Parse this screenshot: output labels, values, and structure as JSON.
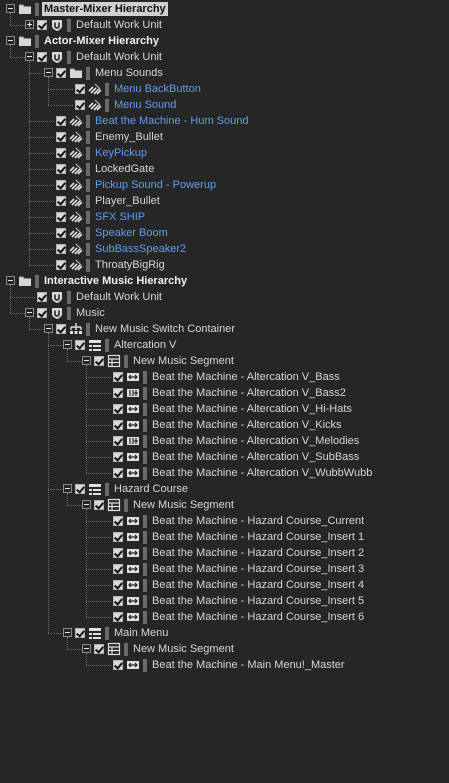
{
  "tree": [
    {
      "label": "Master-Mixer Hierarchy",
      "icon": "folder",
      "expander": "minus",
      "checkbox": false,
      "bold": true,
      "selected": true,
      "blue": false,
      "depth": 0
    },
    {
      "label": "Default Work Unit",
      "icon": "work-unit",
      "expander": "plus",
      "checkbox": true,
      "depth": 1
    },
    {
      "label": "Actor-Mixer Hierarchy",
      "icon": "folder",
      "expander": "minus",
      "checkbox": false,
      "bold": true,
      "depth": 0
    },
    {
      "label": "Default Work Unit",
      "icon": "work-unit",
      "expander": "minus",
      "checkbox": true,
      "depth": 1
    },
    {
      "label": "Menu Sounds",
      "icon": "folder",
      "expander": "minus",
      "checkbox": true,
      "depth": 2
    },
    {
      "label": "Menu BackButton",
      "icon": "sound",
      "expander": "",
      "checkbox": true,
      "blue": true,
      "depth": 3
    },
    {
      "label": "Menu Sound",
      "icon": "sound",
      "expander": "",
      "checkbox": true,
      "blue": true,
      "depth": 3
    },
    {
      "label": "Beat the Machine - Hum Sound",
      "icon": "sound",
      "expander": "",
      "checkbox": true,
      "blue": true,
      "depth": 2
    },
    {
      "label": "Enemy_Bullet",
      "icon": "sound",
      "expander": "",
      "checkbox": true,
      "blue": false,
      "depth": 2
    },
    {
      "label": "KeyPickup",
      "icon": "sound",
      "expander": "",
      "checkbox": true,
      "blue": true,
      "depth": 2
    },
    {
      "label": "LockedGate",
      "icon": "sound",
      "expander": "",
      "checkbox": true,
      "blue": false,
      "depth": 2
    },
    {
      "label": "Pickup Sound - Powerup",
      "icon": "sound",
      "expander": "",
      "checkbox": true,
      "blue": true,
      "depth": 2
    },
    {
      "label": "Player_Bullet",
      "icon": "sound",
      "expander": "",
      "checkbox": true,
      "blue": false,
      "depth": 2
    },
    {
      "label": "SFX SHIP",
      "icon": "sound",
      "expander": "",
      "checkbox": true,
      "blue": true,
      "depth": 2
    },
    {
      "label": "Speaker Boom",
      "icon": "sound",
      "expander": "",
      "checkbox": true,
      "blue": true,
      "depth": 2
    },
    {
      "label": "SubBassSpeaker2",
      "icon": "sound",
      "expander": "",
      "checkbox": true,
      "blue": true,
      "depth": 2
    },
    {
      "label": "ThroatyBigRig",
      "icon": "sound",
      "expander": "",
      "checkbox": true,
      "blue": false,
      "depth": 2
    },
    {
      "label": "Interactive Music Hierarchy",
      "icon": "folder",
      "expander": "minus",
      "checkbox": false,
      "bold": true,
      "depth": 0
    },
    {
      "label": "Default Work Unit",
      "icon": "work-unit",
      "expander": "",
      "checkbox": true,
      "depth": 1
    },
    {
      "label": "Music",
      "icon": "work-unit",
      "expander": "minus",
      "checkbox": true,
      "depth": 1
    },
    {
      "label": "New Music Switch Container",
      "icon": "switch",
      "expander": "minus",
      "checkbox": true,
      "depth": 2
    },
    {
      "label": "Altercation V",
      "icon": "playlist",
      "expander": "minus",
      "checkbox": true,
      "depth": 3
    },
    {
      "label": "New Music Segment",
      "icon": "segment",
      "expander": "minus",
      "checkbox": true,
      "depth": 4
    },
    {
      "label": "Beat the Machine - Altercation V_Bass",
      "icon": "track",
      "expander": "",
      "checkbox": true,
      "depth": 5
    },
    {
      "label": "Beat the Machine - Altercation V_Bass2",
      "icon": "track-alt",
      "expander": "",
      "checkbox": true,
      "depth": 5
    },
    {
      "label": "Beat the Machine - Altercation V_Hi-Hats",
      "icon": "track",
      "expander": "",
      "checkbox": true,
      "depth": 5
    },
    {
      "label": "Beat the Machine - Altercation V_Kicks",
      "icon": "track",
      "expander": "",
      "checkbox": true,
      "depth": 5
    },
    {
      "label": "Beat the Machine - Altercation V_Melodies",
      "icon": "track-alt",
      "expander": "",
      "checkbox": true,
      "depth": 5
    },
    {
      "label": "Beat the Machine - Altercation V_SubBass",
      "icon": "track",
      "expander": "",
      "checkbox": true,
      "depth": 5
    },
    {
      "label": "Beat the Machine - Altercation V_WubbWubb",
      "icon": "track",
      "expander": "",
      "checkbox": true,
      "depth": 5
    },
    {
      "label": "Hazard Course",
      "icon": "playlist",
      "expander": "minus",
      "checkbox": true,
      "depth": 3
    },
    {
      "label": "New Music Segment",
      "icon": "segment",
      "expander": "minus",
      "checkbox": true,
      "depth": 4
    },
    {
      "label": "Beat the Machine - Hazard Course_Current",
      "icon": "track",
      "expander": "",
      "checkbox": true,
      "depth": 5
    },
    {
      "label": "Beat the Machine - Hazard Course_Insert 1",
      "icon": "track",
      "expander": "",
      "checkbox": true,
      "depth": 5
    },
    {
      "label": "Beat the Machine - Hazard Course_Insert 2",
      "icon": "track",
      "expander": "",
      "checkbox": true,
      "depth": 5
    },
    {
      "label": "Beat the Machine - Hazard Course_Insert 3",
      "icon": "track",
      "expander": "",
      "checkbox": true,
      "depth": 5
    },
    {
      "label": "Beat the Machine - Hazard Course_Insert 4",
      "icon": "track",
      "expander": "",
      "checkbox": true,
      "depth": 5
    },
    {
      "label": "Beat the Machine - Hazard Course_Insert 5",
      "icon": "track",
      "expander": "",
      "checkbox": true,
      "depth": 5
    },
    {
      "label": "Beat the Machine - Hazard Course_Insert 6",
      "icon": "track",
      "expander": "",
      "checkbox": true,
      "depth": 5
    },
    {
      "label": "Main Menu",
      "icon": "playlist",
      "expander": "minus",
      "checkbox": true,
      "depth": 3
    },
    {
      "label": "New Music Segment",
      "icon": "segment",
      "expander": "minus",
      "checkbox": true,
      "depth": 4
    },
    {
      "label": "Beat the Machine - Main Menu!_Master",
      "icon": "track",
      "expander": "",
      "checkbox": true,
      "depth": 5
    }
  ]
}
